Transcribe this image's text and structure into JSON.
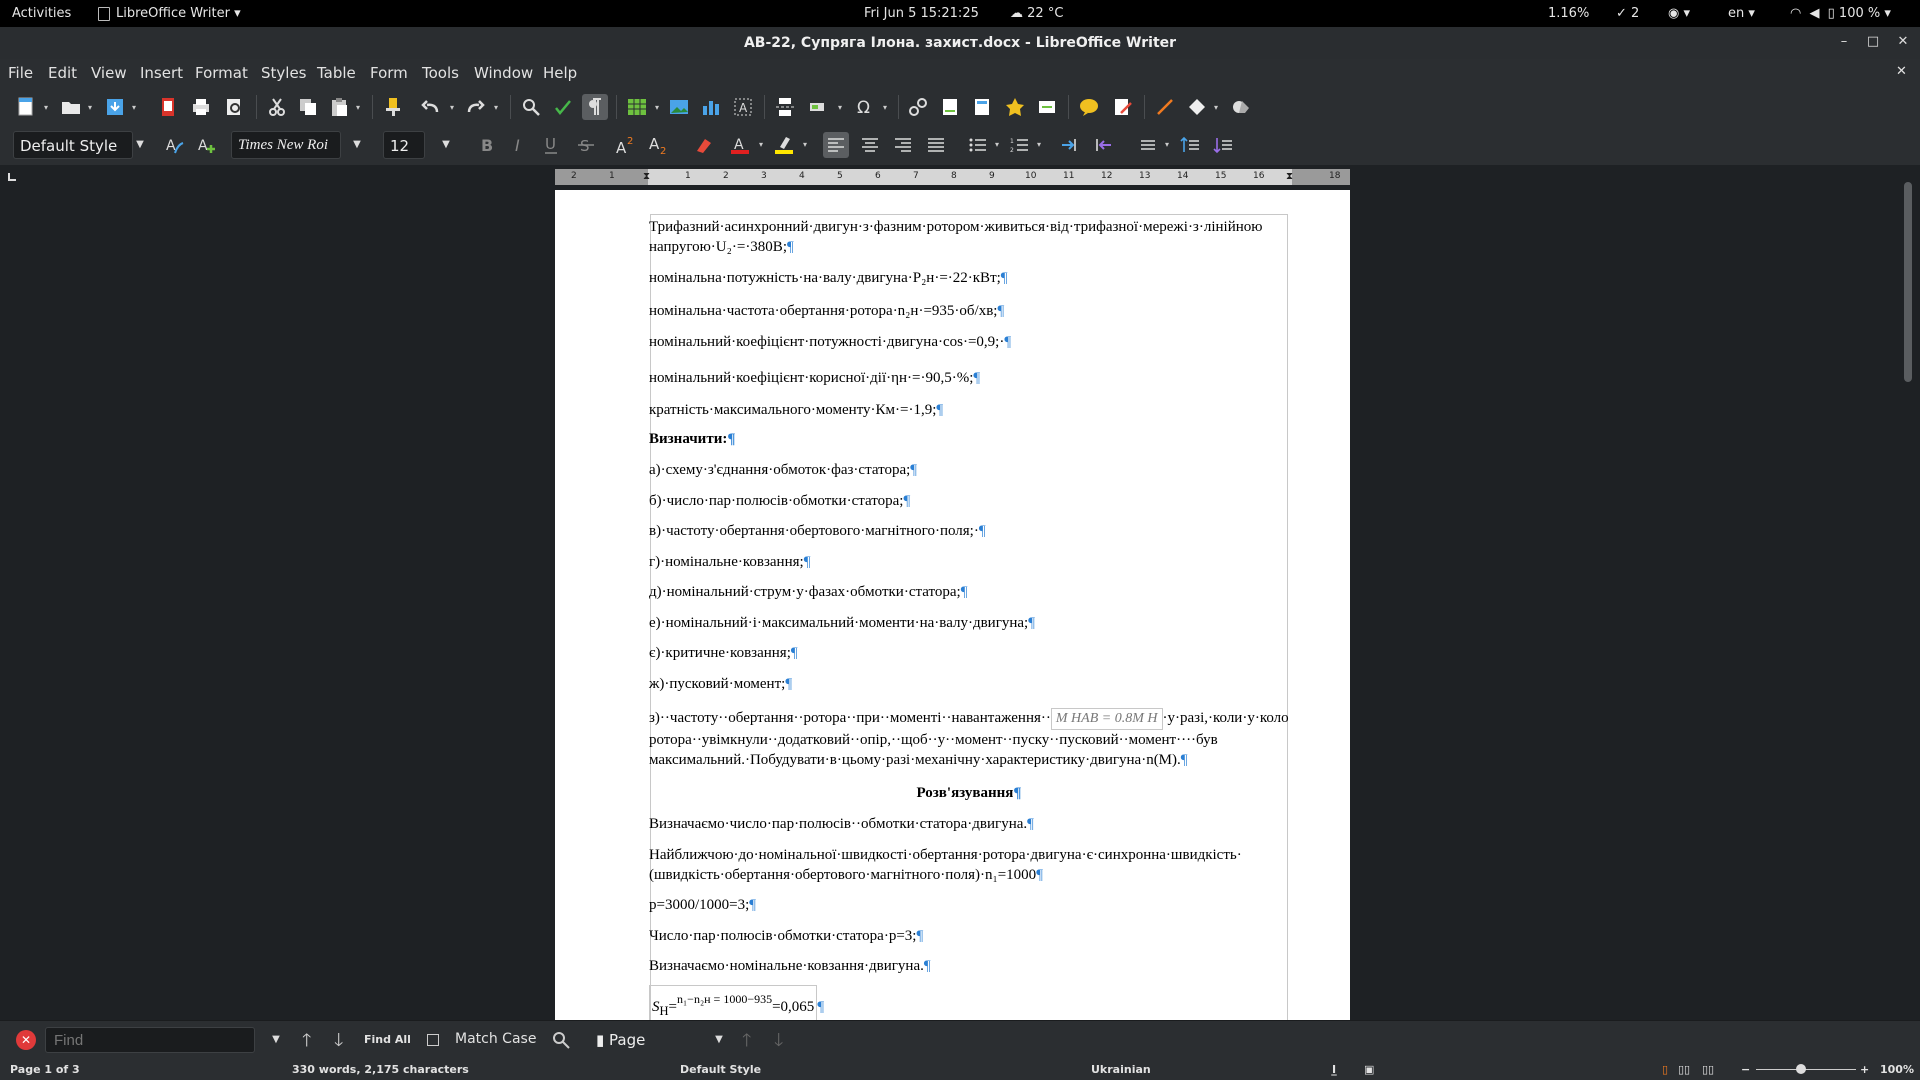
{
  "topbar": {
    "activities": "Activities",
    "app_name": "LibreOffice Writer",
    "datetime": "Fri Jun 5  15:21:25",
    "weather": "22 °C",
    "cpu": "1.16%",
    "updates": "2",
    "language": "en",
    "battery": "100 %"
  },
  "window": {
    "title": "АВ-22, Супряга Ілона. захист.docx - LibreOffice Writer"
  },
  "menubar": {
    "items": [
      "File",
      "Edit",
      "View",
      "Insert",
      "Format",
      "Styles",
      "Table",
      "Form",
      "Tools",
      "Window",
      "Help"
    ]
  },
  "formatting": {
    "paragraph_style": "Default Style",
    "font_name": "Times New Roi",
    "font_size": "12"
  },
  "ruler": {
    "ticks": [
      "2",
      "1",
      "1",
      "2",
      "3",
      "4",
      "5",
      "6",
      "7",
      "8",
      "9",
      "10",
      "11",
      "12",
      "13",
      "14",
      "15",
      "16",
      "17",
      "18"
    ]
  },
  "document": {
    "paragraphs": [
      {
        "text": "Трифазний·асинхронний·двигун·з·фазним·ротором·живиться·від·трифазної·мережі·з·лінійною",
        "line2": "напругою·U₂·=·380В;"
      },
      {
        "text": "номінальна·потужність·на·валу·двигуна·Р₂н·=·22·кВт;"
      },
      {
        "text": "номінальна·частота·обертання·ротора·n₂н·=935·об/хв;"
      },
      {
        "text": "номінальний·коефіцієнт·потужності·двигуна·cos·=0,9;·"
      },
      {
        "text": "номінальний·коефіцієнт·корисної·дії·ηн·=·90,5·%;"
      },
      {
        "text": "кратність·максимального·моменту·Км·=·1,9;"
      },
      {
        "text": "Визначити:"
      },
      {
        "text": "а)·схему·з'єднання·обмоток·фаз·статора;"
      },
      {
        "text": "б)·число·пар·полюсів·обмотки·статора;"
      },
      {
        "text": "в)·частоту·обертання·обертового·магнітного·поля;·"
      },
      {
        "text": "г)·номінальне·ковзання;"
      },
      {
        "text": "д)·номінальний·струм·у·фазах·обмотки·статора;"
      },
      {
        "text": "е)·номінальний·і·максимальний·моменти·на·валу·двигуна;"
      },
      {
        "text": "є)·критичне·ковзання;"
      },
      {
        "text": "ж)·пусковий·момент;"
      },
      {
        "text": "з)··частоту··обертання··ротора··при··моменті··навантаження··",
        "formula": "M НАВ = 0.8M Н",
        "tail": "·у·разі,·коли·у·коло",
        "line2": "ротора··увімкнули··додатковий··опір,··щоб··у··момент··пуску··пусковий··момент····був",
        "line3": "максимальний.·Побудувати·в·цьому·разі·механічну·характеристику·двигуна·n(M)."
      },
      {
        "text": "Розв'язування"
      },
      {
        "text": "Визначаємо·число·пар·полюсів··обмотки·статора·двигуна."
      },
      {
        "text": "Найближчою·до·номінальної·швидкості·обертання·ротора·двигуна·є·синхронна·швидкість·",
        "line2": "(швидкість·обертання·обертового·магнітного·поля)·n₁=1000"
      },
      {
        "text": "р=3000/1000=3;"
      },
      {
        "text": "Число·пар·полюсів·обмотки·статора·р=3;"
      },
      {
        "text": "Визначаємо·номінальне·ковзання·двигуна."
      },
      {
        "text": "S",
        "formula": "n₁−n₂н  =  1000−935",
        "tail": "=0,065"
      }
    ],
    "formula_sub": "Н"
  },
  "findbar": {
    "placeholder": "Find",
    "find_all": "Find All",
    "match_case": "Match Case",
    "nav_target": "Page"
  },
  "statusbar": {
    "page": "Page 1 of 3",
    "words": "330 words, 2,175 characters",
    "style": "Default Style",
    "language": "Ukrainian",
    "zoom": "100%"
  },
  "colors": {
    "formatting_mark": "#2a7fd4",
    "toolbar_bg": "#2b2e31",
    "page_bg": "#ffffff"
  }
}
